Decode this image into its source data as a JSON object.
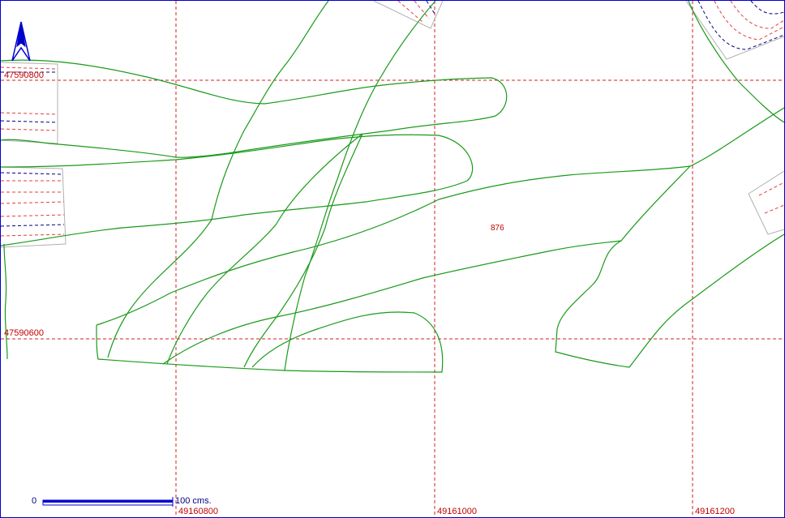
{
  "map": {
    "grid_labels": {
      "y_top": "47590800",
      "y_bottom": "47590600",
      "x_left": "49160800",
      "x_mid": "49161000",
      "x_right": "49161200"
    },
    "feature_label": "876",
    "scale": {
      "zero": "0",
      "unit": "100 cms."
    },
    "colors": {
      "grid": "#d02020",
      "contour": "#1a9a1a",
      "frame": "#0000cc",
      "north_arrow": "#0000cc",
      "label": "#c00000"
    },
    "icons": {
      "north_arrow": "north-arrow-icon"
    }
  }
}
